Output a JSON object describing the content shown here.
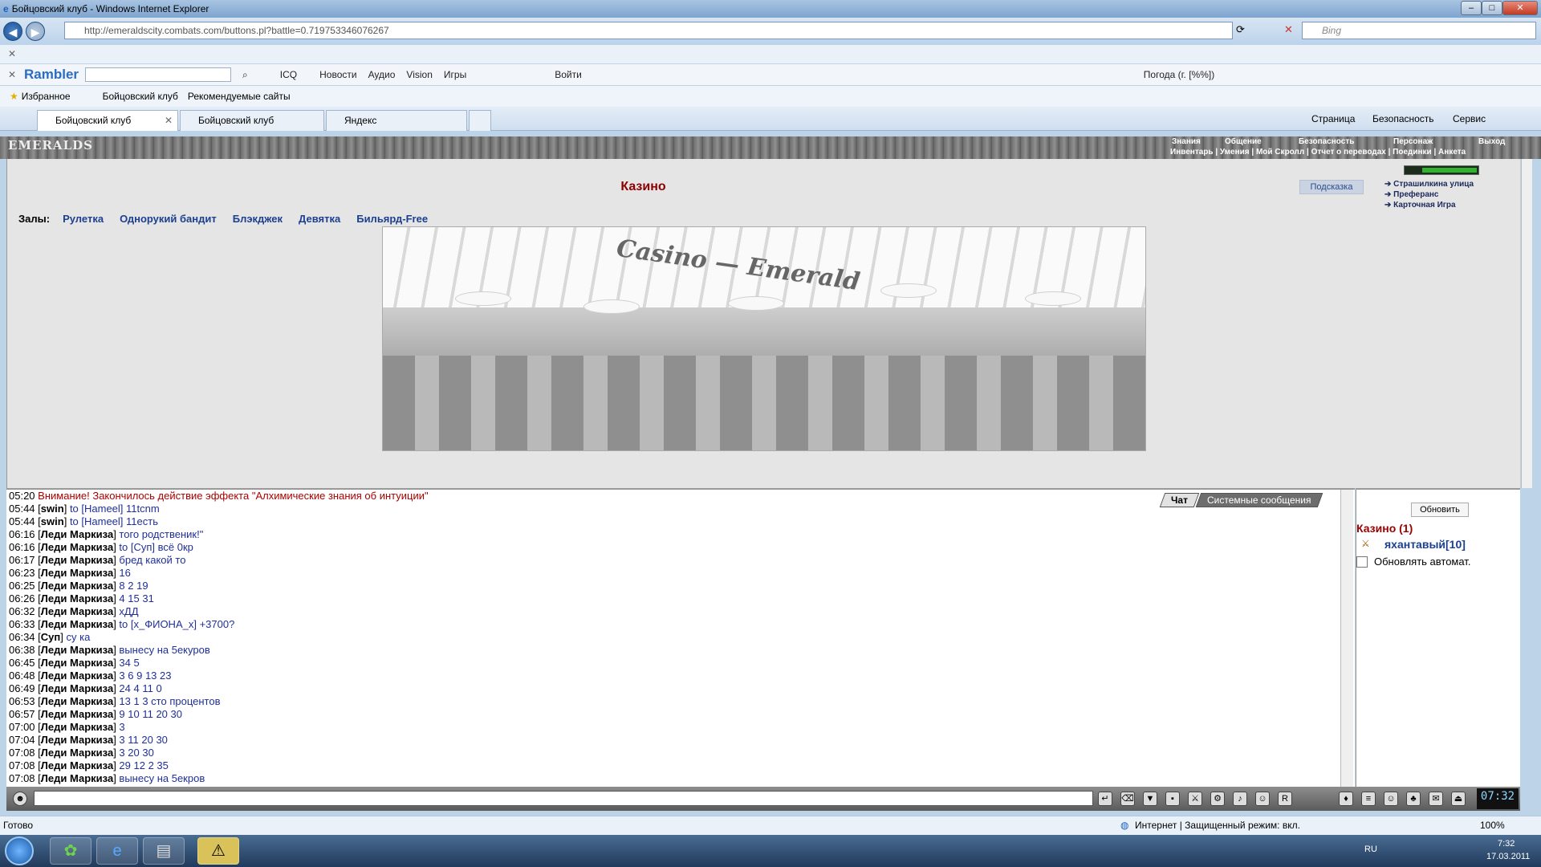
{
  "window": {
    "title": "Бойцовский клуб - Windows Internet Explorer"
  },
  "address": {
    "url": "http://emeraldscity.combats.com/buttons.pl?battle=0.719753346076267",
    "search_placeholder": "Bing"
  },
  "rambler": {
    "logo": "Rambler",
    "items": [
      "ICQ",
      "Новости",
      "Аудио",
      "Vision",
      "Игры",
      "Войти",
      "Погода (г. [%%])"
    ]
  },
  "favorites": {
    "items": [
      "Избранное",
      "Бойцовский клуб",
      "Рекомендуемые сайты"
    ]
  },
  "tabs": [
    {
      "label": "Бойцовский клуб"
    },
    {
      "label": "Бойцовский клуб"
    },
    {
      "label": "Яндекс"
    }
  ],
  "ie_menu": [
    "Страница",
    "Безопасность",
    "Сервис"
  ],
  "game": {
    "logo": "EMERALDS",
    "top_menu": [
      "Знания",
      "Общение",
      "Безопасность",
      "Персонаж",
      "Выход"
    ],
    "sub_menu": "Инвентарь | Умения | Мой Скролл | Отчет о переводах | Поединки | Анкета",
    "casino_title": "Казино",
    "halls_label": "Залы:",
    "halls": [
      "Рулетка",
      "Однорукий бандит",
      "Блэкджек",
      "Девятка",
      "Бильярд-Free"
    ],
    "hint_button": "Подсказка",
    "right_links": [
      "Страшилкина улица",
      "Преферанс",
      "Карточная Игра"
    ],
    "image_caption": "Casino — Emerald"
  },
  "chat": {
    "tabs": [
      "Чат",
      "Системные сообщения"
    ],
    "lines": [
      {
        "time": "05:20",
        "name": "",
        "text": "Внимание! Закончилось действие эффекта \"Алхимические знания об интуиции\""
      },
      {
        "time": "05:44",
        "name": "swin",
        "text": "to [Hameel] 11tcnm"
      },
      {
        "time": "05:44",
        "name": "swin",
        "text": "to [Hameel] 11есть"
      },
      {
        "time": "06:16",
        "name": "Леди Маркиза",
        "text": "того родственик!\""
      },
      {
        "time": "06:16",
        "name": "Леди Маркиза",
        "text": "to [Суп] всё 0кр"
      },
      {
        "time": "06:17",
        "name": "Леди Маркиза",
        "text": "бред какой то"
      },
      {
        "time": "06:23",
        "name": "Леди Маркиза",
        "text": "16"
      },
      {
        "time": "06:25",
        "name": "Леди Маркиза",
        "text": "8 2 19"
      },
      {
        "time": "06:26",
        "name": "Леди Маркиза",
        "text": "4 15 31"
      },
      {
        "time": "06:32",
        "name": "Леди Маркиза",
        "text": "хДД"
      },
      {
        "time": "06:33",
        "name": "Леди Маркиза",
        "text": "to [x_ФИОНА_x] +3700?"
      },
      {
        "time": "06:34",
        "name": "Суп",
        "text": "су ка"
      },
      {
        "time": "06:38",
        "name": "Леди Маркиза",
        "text": "вынесу на 5екуров"
      },
      {
        "time": "06:45",
        "name": "Леди Маркиза",
        "text": "34 5"
      },
      {
        "time": "06:48",
        "name": "Леди Маркиза",
        "text": "3 6 9 13 23"
      },
      {
        "time": "06:49",
        "name": "Леди Маркиза",
        "text": "24 4 11 0"
      },
      {
        "time": "06:53",
        "name": "Леди Маркиза",
        "text": "13 1 3 сто процентов"
      },
      {
        "time": "06:57",
        "name": "Леди Маркиза",
        "text": "9 10 11 20 30"
      },
      {
        "time": "07:00",
        "name": "Леди Маркиза",
        "text": "3"
      },
      {
        "time": "07:04",
        "name": "Леди Маркиза",
        "text": "3 11 20 30"
      },
      {
        "time": "07:08",
        "name": "Леди Маркиза",
        "text": "3 20 30"
      },
      {
        "time": "07:08",
        "name": "Леди Маркиза",
        "text": "29 12 2 35"
      },
      {
        "time": "07:08",
        "name": "Леди Маркиза",
        "text": "вынесу на 5екров"
      }
    ]
  },
  "right_panel": {
    "refresh_button": "Обновить",
    "room": "Казино (1)",
    "user": "яхантавый[10]",
    "auto_refresh_label": "Обновлять автомат."
  },
  "chatbar": {
    "clock": "07:32"
  },
  "statusbar": {
    "left": "Готово",
    "zone": "Интернет | Защищенный режим: вкл.",
    "zoom": "100%"
  },
  "taskbar": {
    "lang": "RU",
    "time": "7:32",
    "date": "17.03.2011"
  }
}
